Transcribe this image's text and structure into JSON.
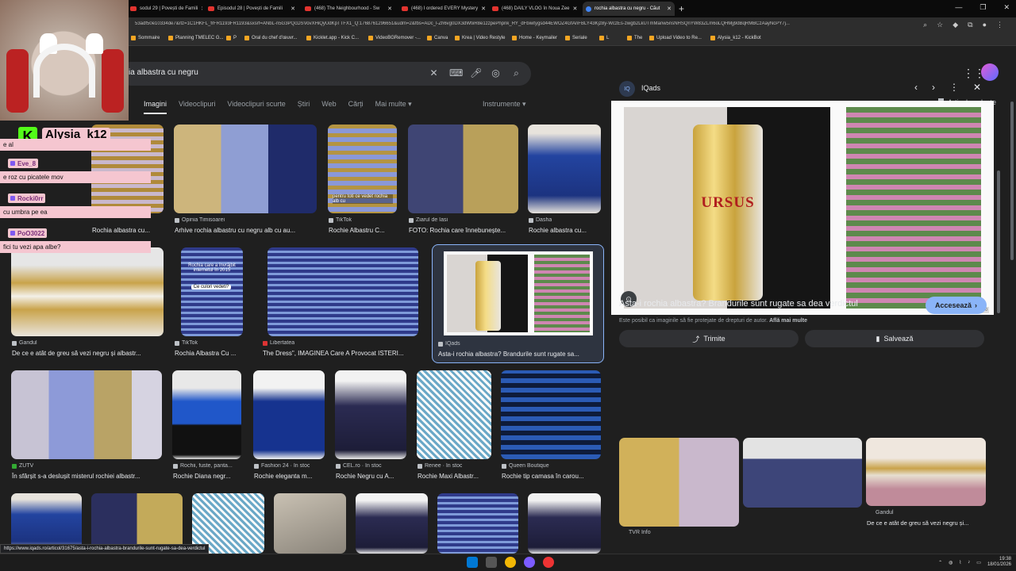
{
  "browser": {
    "tabs": [
      {
        "label": "sodul 29 | Povești de Famili",
        "active": false
      },
      {
        "label": "Episodul 28 | Povești de Famili",
        "active": false
      },
      {
        "label": "(468) The Neighbourhood - Sw",
        "active": false
      },
      {
        "label": "(468) I ordered EVERY Mystery",
        "active": false
      },
      {
        "label": "(468) DAILY VLOG în Noua Zee",
        "active": false
      },
      {
        "label": "rochia albastra cu negru - Căut",
        "active": true
      }
    ],
    "new_tab": "+",
    "url": "53adf50e10334de7&rlz=1C1HKFL_frFR1193FR1193&sxsrf=ANbL-n5G3PQcDSVovXHiQyUdKpTTFX1_Q:1768761296651&udm=2&fbs=ADc_l-Zh6vg0DX3dWtiiR8e1zzpePhpnk_RY_dFbiwtygsd44EWOZ4GfAnFBLY43Kjz8y-WczEs-zwgb2LkUTmManw5nsNHSQnYW83ZLm6oLQHMjj9dBqRMBCzAayNcPY7j...",
    "bookmarks": [
      "Sommaire",
      "Planning TMELEC G...",
      "P",
      "Oral du chef d'œuvr...",
      "Kicklet.app - Kick C...",
      "VideoBGRemover -...",
      "Canva",
      "Krea | Video Restyle",
      "Home - Keymailer",
      "Seriale",
      "The",
      "L",
      "Upload Video to Re...",
      "Alysia_k12 - KickBot"
    ],
    "status_url": "https://www.iqads.ro/articol/31675/asta-i-rochia-albastra-brandurile-sunt-rugate-sa-dea-verdictul"
  },
  "search": {
    "query": "ia albastra cu negru",
    "tabs": [
      "Imagini",
      "Videoclipuri",
      "Videoclipuri scurte",
      "Știri",
      "Web",
      "Cărți",
      "Mai multe"
    ],
    "active_tab": "Imagini",
    "tools": "Instrumente",
    "saved": "Articole salvate"
  },
  "results": [
    {
      "source": "",
      "title": "Rochia albastra cu..."
    },
    {
      "source": "Opinia Timisoarei",
      "title": "Arhive rochia albastru cu negru alb cu au..."
    },
    {
      "source": "TikTok",
      "title": "Rochie Albastru C..."
    },
    {
      "source": "Ziarul de Iasi",
      "title": "FOTO: Rochia care înnebunește..."
    },
    {
      "source": "Dasha",
      "title": "Rochie albastra cu..."
    },
    {
      "source": "Gandul",
      "title": "De ce e atât de greu să vezi negru și albastr..."
    },
    {
      "source": "TikTok",
      "title": "Rochia Albastra Cu ..."
    },
    {
      "source": "Libertatea",
      "title": "The Dress\", IMAGINEA Care A Provocat ISTERI..."
    },
    {
      "source": "IQads",
      "title": "Asta-i rochia albastra? Brandurile sunt rugate sa..."
    },
    {
      "source": "ZUTV",
      "title": "În sfârșit s-a deslușit misterul rochiei albastr..."
    },
    {
      "source": "Rochii, fuste, panta...",
      "title": "Rochie Diana negr..."
    },
    {
      "source": "Fashion 24 · În stoc",
      "title": "Rochie eleganta m..."
    },
    {
      "source": "CEL.ro · În stoc",
      "title": "Rochie Negru cu A..."
    },
    {
      "source": "Renee · În stoc",
      "title": "Rochie Maxi Albastr..."
    },
    {
      "source": "Queen Boutique",
      "title": "Rochie tip camasa în carou..."
    }
  ],
  "overlay_texts": {
    "img3": "pentru toti ce vedet rochia alb cu",
    "img7a": "Rochia care a învrăjbit internetul în 2015",
    "img7b": "Ce culori vedeti?"
  },
  "panel": {
    "site": "IQads",
    "logo": "IQ",
    "title": "Asta-i rochia albastra? Brandurile sunt rugate sa dea verdictul",
    "visit": "Accesează",
    "copyright": "Este posibil ca imaginile să fie protejate de drepturi de autor.",
    "learn_more": "Află mai multe",
    "share": "Trimite",
    "save": "Salvează",
    "dims": "800 × 450",
    "can_brand": "URSUS",
    "related": [
      {
        "source": "TVR Info",
        "title": ""
      },
      {
        "source": "",
        "title": ""
      },
      {
        "source": "Gandul",
        "title": "De ce e atât de greu să vezi negru și..."
      }
    ]
  },
  "overlay": {
    "streamer": "Alysia_k12",
    "logo": "K",
    "messages": [
      {
        "user": "",
        "text": "e al"
      },
      {
        "user": "Eve_8",
        "text": "e roz cu picatele mov"
      },
      {
        "user": "Rocki0rr",
        "text": "cu umbra pe ea"
      },
      {
        "user": "PoO3022",
        "text": "fici tu vezi apa albe?"
      }
    ]
  },
  "taskbar": {
    "time": "19:38",
    "date": "18/01/2026"
  },
  "colors": {
    "accent": "#8ab4f8",
    "bg": "#1f1f1f",
    "kick": "#53fc18",
    "chat": "#f5c6d0"
  }
}
